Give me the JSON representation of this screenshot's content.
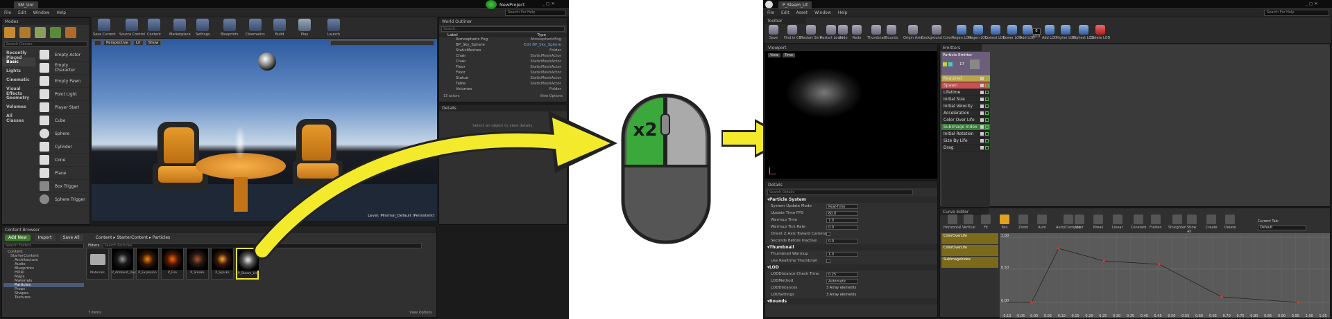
{
  "left": {
    "title": "SM_Unr",
    "project": "NewProject",
    "search_help": "Search For Help",
    "menu": [
      "File",
      "Edit",
      "Window",
      "Help"
    ],
    "modes_tab": "Modes",
    "search_classes": "Search Classes",
    "categories": [
      "Recently Placed",
      "Basic",
      "Lights",
      "Cinematic",
      "Visual Effects",
      "Geometry",
      "Volumes",
      "All Classes"
    ],
    "placeables": [
      "Empty Actor",
      "Empty Character",
      "Empty Pawn",
      "Point Light",
      "Player Start",
      "Cube",
      "Sphere",
      "Cylinder",
      "Cone",
      "Plane",
      "Box Trigger",
      "Sphere Trigger"
    ],
    "toolbar": [
      "Save Current",
      "Source Control",
      "Content",
      "Marketplace",
      "Settings",
      "Blueprints",
      "Cinematics",
      "Build",
      "Play",
      "Launch"
    ],
    "viewport": {
      "perspective": "Perspective",
      "lit": "Lit",
      "show": "Show",
      "level": "Level: Minimal_Default (Persistent)"
    },
    "outliner": {
      "tab": "World Outliner",
      "search": "Search...",
      "col_label": "Label",
      "col_type": "Type",
      "rows": [
        {
          "label": "Atmospheric Fog",
          "type": "AtmosphericFog"
        },
        {
          "label": "BP_Sky_Sphere",
          "type": "Edit BP_Sky_Sphere"
        },
        {
          "label": "StaticMeshes",
          "type": "Folder"
        },
        {
          "label": "Chair",
          "type": "StaticMeshActor"
        },
        {
          "label": "Chair",
          "type": "StaticMeshActor"
        },
        {
          "label": "Floor",
          "type": "StaticMeshActor"
        },
        {
          "label": "Floor",
          "type": "StaticMeshActor"
        },
        {
          "label": "Statue",
          "type": "StaticMeshActor"
        },
        {
          "label": "Table",
          "type": "StaticMeshActor"
        },
        {
          "label": "Volumes",
          "type": "Folder"
        }
      ],
      "count": "15 actors",
      "view_options": "View Options"
    },
    "details": {
      "tab": "Details",
      "hint": "Select an object to view details."
    },
    "content_browser": {
      "tab": "Content Browser",
      "add_new": "Add New",
      "import": "Import",
      "save_all": "Save All",
      "path": [
        "Content",
        "StarterContent",
        "Particles"
      ],
      "filters": "Filters",
      "search": "Search Particles",
      "search_folders": "Search Folders",
      "tree": [
        "Content",
        "StarterContent",
        "Architecture",
        "Audio",
        "Blueprints",
        "HDRI",
        "Maps",
        "Materials",
        "Particles",
        "Props",
        "Shapes",
        "Textures"
      ],
      "assets": [
        "Materials",
        "P_Ambient_Dust",
        "P_Explosion",
        "P_Fire",
        "P_Smoke",
        "P_Sparks",
        "P_Steam_Lit"
      ],
      "item_count": "7 items",
      "view_options": "View Options"
    }
  },
  "mouse": {
    "label": "x2",
    "accent": "#3aa83a"
  },
  "right": {
    "title": "P_Steam_Lit",
    "search_help": "Search For Help",
    "menu": [
      "File",
      "Edit",
      "Asset",
      "Window",
      "Help"
    ],
    "toolbar_tab": "Toolbar",
    "toolbar": [
      "Save",
      "Find in CB",
      "Restart Sim",
      "Restart Level",
      "Undo",
      "Redo",
      "Thumbnail",
      "Bounds",
      "Origin Axis",
      "Background Color",
      "Regen LOD",
      "Regen LOD",
      "Lowest LOD",
      "Lower LOD",
      "Add LOD",
      "LOD",
      "Add LOD",
      "Higher LOD",
      "Highest LOD",
      "Delete LOD"
    ],
    "lod_value": "0",
    "viewport_tab": "Viewport",
    "viewport_buttons": [
      "View",
      "Time"
    ],
    "emitters_tab": "Emitters",
    "emitter_name": "Particle Emitter",
    "emitter_count": "17",
    "modules": [
      {
        "name": "Required",
        "color": "#b8a84a"
      },
      {
        "name": "Spawn",
        "color": "#c85050"
      },
      {
        "name": "Lifetime",
        "color": ""
      },
      {
        "name": "Initial Size",
        "color": ""
      },
      {
        "name": "Initial Velocity",
        "color": ""
      },
      {
        "name": "Acceleration",
        "color": ""
      },
      {
        "name": "Color Over Life",
        "color": ""
      },
      {
        "name": "SubImage Index",
        "color": "#3a7a3a"
      },
      {
        "name": "Initial Rotation",
        "color": ""
      },
      {
        "name": "Size By Life",
        "color": ""
      },
      {
        "name": "Drag",
        "color": ""
      }
    ],
    "details": {
      "tab": "Details",
      "search": "Search Details",
      "sections": [
        {
          "title": "Particle System",
          "rows": [
            {
              "label": "System Update Mode",
              "value": "Real-Time"
            },
            {
              "label": "Update Time FPS",
              "value": "60.0"
            },
            {
              "label": "Warmup Time",
              "value": "7.0"
            },
            {
              "label": "Warmup Tick Rate",
              "value": "0.0"
            },
            {
              "label": "Orient Z Axis Toward Camera",
              "value": ""
            },
            {
              "label": "Seconds Before Inactive",
              "value": "0.0"
            }
          ]
        },
        {
          "title": "Thumbnail",
          "rows": [
            {
              "label": "Thumbnail Warmup",
              "value": "1.0"
            },
            {
              "label": "Use Realtime Thumbnail",
              "value": ""
            }
          ]
        },
        {
          "title": "LOD",
          "rows": [
            {
              "label": "LODDistance Check Time",
              "value": "0.25"
            },
            {
              "label": "LODMethod",
              "value": "Automatic"
            },
            {
              "label": "LODDistances",
              "value": "3 Array elements"
            },
            {
              "label": "LODSettings",
              "value": "3 Array elements"
            }
          ]
        },
        {
          "title": "Bounds",
          "rows": []
        }
      ]
    },
    "curve_editor": {
      "tab": "Curve Editor",
      "tools": [
        "Horizontal",
        "Vertical",
        "Fit",
        "Pan",
        "Zoom",
        "Auto",
        "Auto/Clamped",
        "User",
        "Break",
        "Linear",
        "Constant",
        "Flatten",
        "Straighten",
        "Show All",
        "Create",
        "Delete"
      ],
      "current_tab_label": "Current Tab:",
      "current_tab": "Default",
      "tracks": [
        "ColorOverLife",
        "ColorOverLife",
        "SubImageIndex"
      ],
      "y_ticks": [
        "1.00",
        "0.50",
        "0.00"
      ],
      "x_ticks": [
        "-0.10",
        "-0.05",
        "0.00",
        "0.05",
        "0.10",
        "0.15",
        "0.20",
        "0.25",
        "0.30",
        "0.35",
        "0.40",
        "0.45",
        "0.50",
        "0.55",
        "0.60",
        "0.65",
        "0.70",
        "0.75",
        "0.80",
        "0.85",
        "0.90",
        "0.95",
        "1.00",
        "1.05"
      ]
    }
  }
}
